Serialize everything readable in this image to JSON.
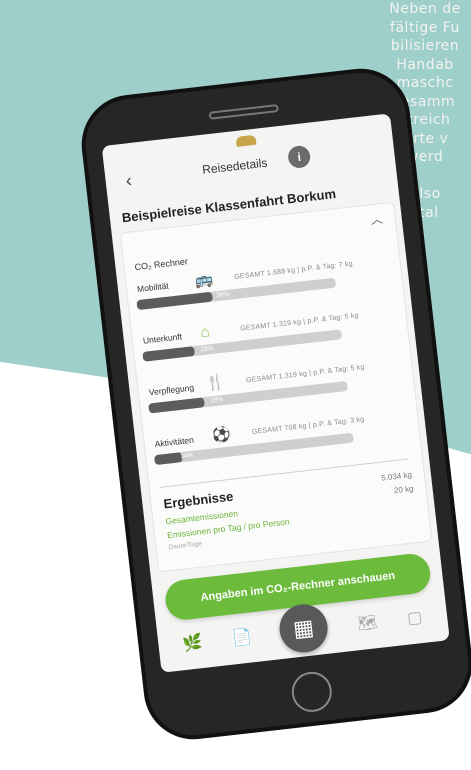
{
  "colors": {
    "background_teal": "#9ecfca",
    "accent_green": "#6cbb3c",
    "bar_dark": "#5c5c5c",
    "phone_body": "#262626"
  },
  "side_text": {
    "lines": [
      "Neben de",
      "fältige Fu",
      "bilisieren",
      "Handab",
      "maschc",
      "tesamm",
      "streich",
      "Orte v",
      "werd",
      "",
      "Also",
      "stal"
    ]
  },
  "app": {
    "header_title": "Reisedetails",
    "trip_title": "Beispielreise Klassenfahrt Borkum",
    "calculator_label": "CO₂ Rechner",
    "categories": [
      {
        "label": "Mobilität",
        "icon": "bus-icon",
        "total": "GESAMT 1.688 kg | p.P. & Tag: 7 kg",
        "percent_text": "38%",
        "percent": 38
      },
      {
        "label": "Unterkunft",
        "icon": "house-icon",
        "total": "GESAMT 1.319 kg | p.P. & Tag: 5 kg",
        "percent_text": "26%",
        "percent": 26
      },
      {
        "label": "Verpflegung",
        "icon": "food-icon",
        "total": "GESAMT 1.319 kg | p.P. & Tag: 5 kg",
        "percent_text": "28%",
        "percent": 28
      },
      {
        "label": "Aktivitäten",
        "icon": "activity-icon",
        "total": "GESAMT 708 kg | p.P. & Tag: 3 kg",
        "percent_text": "14%",
        "percent": 14
      }
    ],
    "results": {
      "title": "Ergebnisse",
      "line1": "Gesamtemissionen",
      "line2": "Emissionen pro Tag / pro Person",
      "line3": "Dauer/Tage",
      "value1": "5.034 kg",
      "value2": "20 kg"
    },
    "cta_label": "Angaben im CO₂-Rechner anschauen",
    "nav": {
      "home_icon": "logo-icon",
      "doc_icon": "document-icon",
      "calc_icon": "calculator-icon",
      "map_icon": "map-icon",
      "profile_icon": "profile-icon"
    }
  }
}
